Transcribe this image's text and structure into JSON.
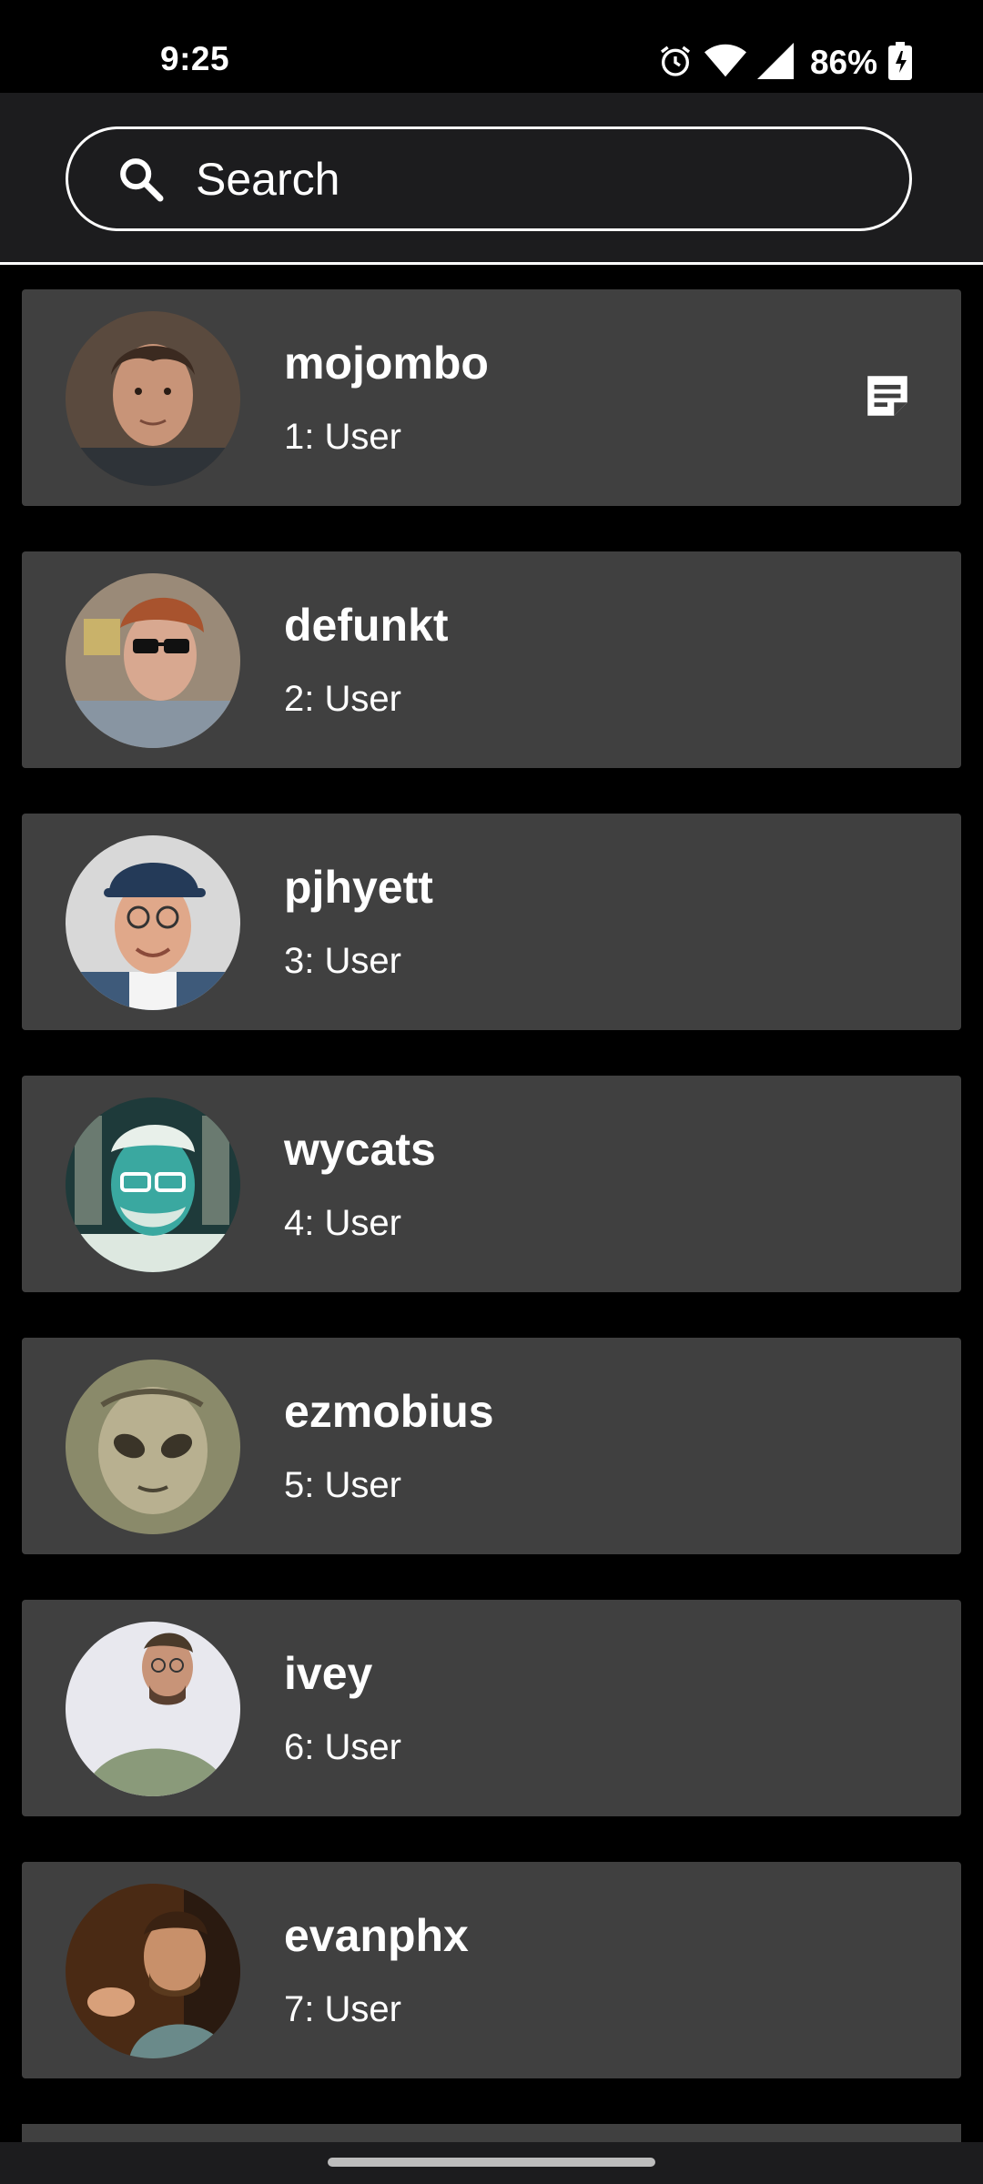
{
  "status_bar": {
    "time": "9:25",
    "battery_percent": "86%",
    "icons": [
      "alarm-icon",
      "wifi-icon",
      "cell-signal-icon",
      "battery-charging-icon"
    ]
  },
  "search": {
    "placeholder": "Search",
    "value": ""
  },
  "users": [
    {
      "name": "mojombo",
      "subtitle": "1: User",
      "avatar_icon": "avatar-photo",
      "has_note": true
    },
    {
      "name": "defunkt",
      "subtitle": "2: User",
      "avatar_icon": "avatar-photo",
      "has_note": false
    },
    {
      "name": "pjhyett",
      "subtitle": "3: User",
      "avatar_icon": "avatar-photo",
      "has_note": false
    },
    {
      "name": "wycats",
      "subtitle": "4: User",
      "avatar_icon": "avatar-photo",
      "has_note": false
    },
    {
      "name": "ezmobius",
      "subtitle": "5: User",
      "avatar_icon": "avatar-photo",
      "has_note": false
    },
    {
      "name": "ivey",
      "subtitle": "6: User",
      "avatar_icon": "avatar-photo",
      "has_note": false
    },
    {
      "name": "evanphx",
      "subtitle": "7: User",
      "avatar_icon": "avatar-photo",
      "has_note": false
    }
  ],
  "colors": {
    "background": "#000000",
    "card": "#404040",
    "header": "#1c1c1e",
    "text": "#ffffff"
  }
}
